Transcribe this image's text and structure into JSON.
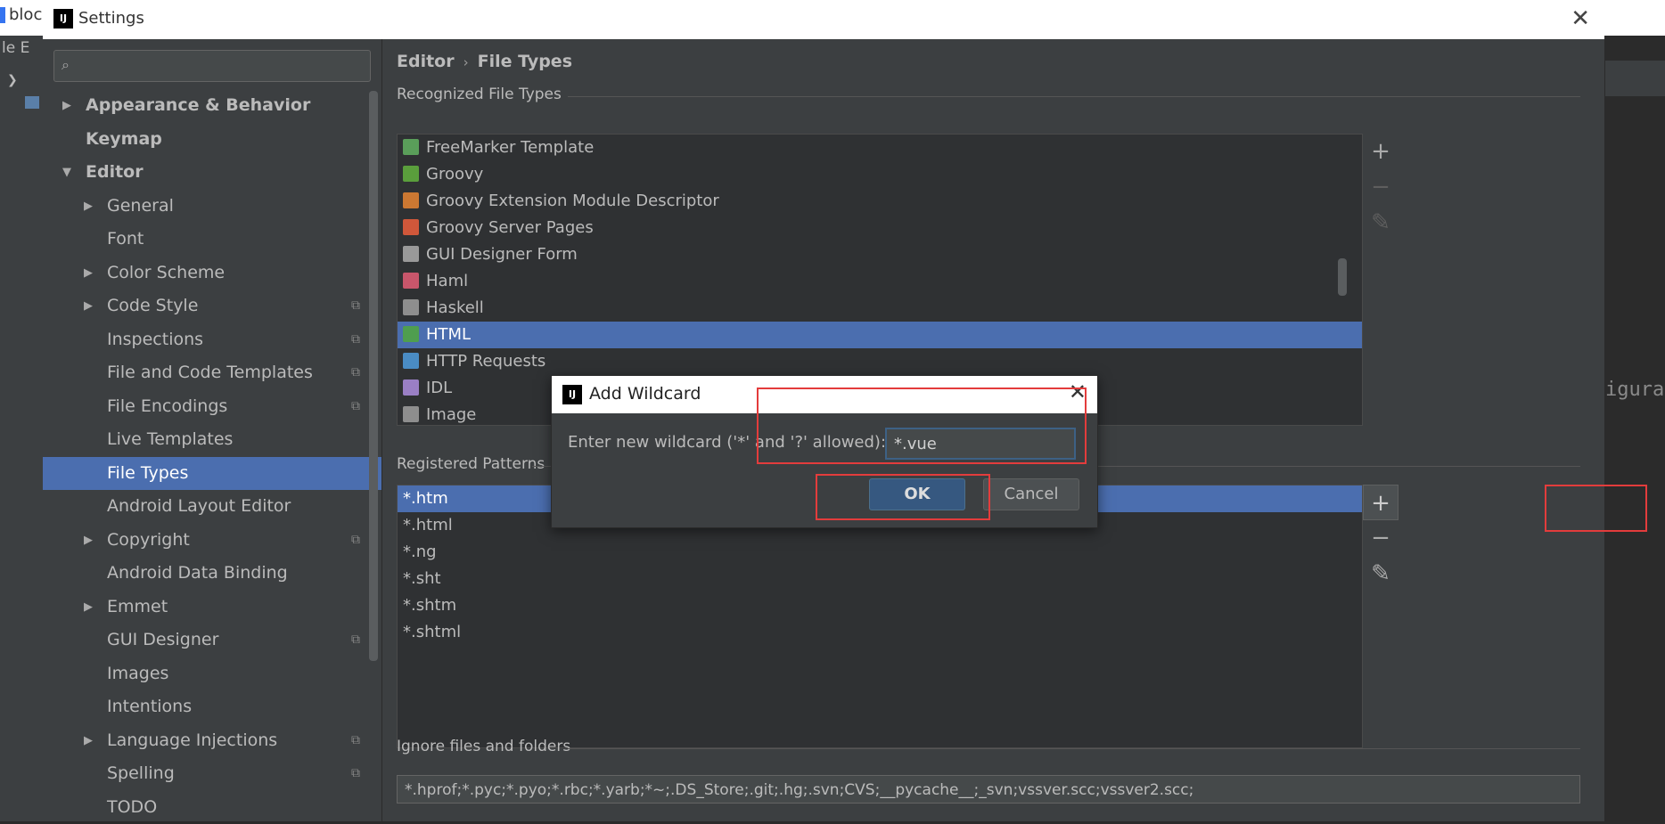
{
  "background": {
    "window_title": "block",
    "menu": "le  E",
    "right_text": "igura"
  },
  "settings": {
    "title": "Settings",
    "search": {
      "placeholder": ""
    },
    "tree": [
      {
        "label": "Appearance & Behavior",
        "bold": true,
        "arrow": "right",
        "indent": 0,
        "copy": false
      },
      {
        "label": "Keymap",
        "bold": true,
        "arrow": "",
        "indent": 0,
        "copy": false
      },
      {
        "label": "Editor",
        "bold": true,
        "arrow": "down",
        "indent": 0,
        "copy": false
      },
      {
        "label": "General",
        "arrow": "right",
        "indent": 1,
        "copy": false
      },
      {
        "label": "Font",
        "arrow": "",
        "indent": 1,
        "copy": false
      },
      {
        "label": "Color Scheme",
        "arrow": "right",
        "indent": 1,
        "copy": false
      },
      {
        "label": "Code Style",
        "arrow": "right",
        "indent": 1,
        "copy": true
      },
      {
        "label": "Inspections",
        "arrow": "",
        "indent": 1,
        "copy": true
      },
      {
        "label": "File and Code Templates",
        "arrow": "",
        "indent": 1,
        "copy": true
      },
      {
        "label": "File Encodings",
        "arrow": "",
        "indent": 1,
        "copy": true
      },
      {
        "label": "Live Templates",
        "arrow": "",
        "indent": 1,
        "copy": false
      },
      {
        "label": "File Types",
        "arrow": "",
        "indent": 1,
        "copy": false,
        "selected": true
      },
      {
        "label": "Android Layout Editor",
        "arrow": "",
        "indent": 1,
        "copy": false
      },
      {
        "label": "Copyright",
        "arrow": "right",
        "indent": 1,
        "copy": true
      },
      {
        "label": "Android Data Binding",
        "arrow": "",
        "indent": 1,
        "copy": false
      },
      {
        "label": "Emmet",
        "arrow": "right",
        "indent": 1,
        "copy": false
      },
      {
        "label": "GUI Designer",
        "arrow": "",
        "indent": 1,
        "copy": true
      },
      {
        "label": "Images",
        "arrow": "",
        "indent": 1,
        "copy": false
      },
      {
        "label": "Intentions",
        "arrow": "",
        "indent": 1,
        "copy": false
      },
      {
        "label": "Language Injections",
        "arrow": "right",
        "indent": 1,
        "copy": true
      },
      {
        "label": "Spelling",
        "arrow": "",
        "indent": 1,
        "copy": true
      },
      {
        "label": "TODO",
        "arrow": "",
        "indent": 1,
        "copy": false
      }
    ],
    "breadcrumb": [
      "Editor",
      "File Types"
    ],
    "recognized_title": "Recognized File Types",
    "file_types": [
      {
        "label": "FreeMarker Template",
        "icon": "ftl",
        "color": "#5a9e5a"
      },
      {
        "label": "Groovy",
        "icon": "G",
        "color": "#5a9e3c"
      },
      {
        "label": "Groovy Extension Module Descriptor",
        "icon": "bar",
        "color": "#cc7832"
      },
      {
        "label": "Groovy Server Pages",
        "icon": "GSP",
        "color": "#d0573a"
      },
      {
        "label": "GUI Designer Form",
        "icon": "form",
        "color": "#999999"
      },
      {
        "label": "Haml",
        "icon": "h",
        "color": "#c8566b"
      },
      {
        "label": "Haskell",
        "icon": "hs",
        "color": "#8e8e8e"
      },
      {
        "label": "HTML",
        "icon": "H",
        "color": "#4f9e4f",
        "selected": true
      },
      {
        "label": "HTTP Requests",
        "icon": "API",
        "color": "#4a8cc4"
      },
      {
        "label": "IDL",
        "icon": "IDL",
        "color": "#9a7fc4"
      },
      {
        "label": "Image",
        "icon": "img",
        "color": "#8e8e8e"
      }
    ],
    "patterns_title": "Registered Patterns",
    "patterns": [
      {
        "label": "*.htm",
        "selected": true
      },
      {
        "label": "*.html"
      },
      {
        "label": "*.ng"
      },
      {
        "label": "*.sht"
      },
      {
        "label": "*.shtm"
      },
      {
        "label": "*.shtml"
      }
    ],
    "ignore_title": "Ignore files and folders",
    "ignore_value": "*.hprof;*.pyc;*.pyo;*.rbc;*.yarb;*~;.DS_Store;.git;.hg;.svn;CVS;__pycache__;_svn;vssver.scc;vssver2.scc;",
    "toolbar": {
      "add": "+",
      "remove": "−",
      "edit": "✎"
    }
  },
  "dialog": {
    "title": "Add Wildcard",
    "label": "Enter new wildcard ('*' and '?' allowed):",
    "input_value": "*.vue",
    "ok": "OK",
    "cancel": "Cancel"
  },
  "colors": {
    "selection": "#4b6eaf",
    "panel": "#3c3f41",
    "annotation": "#e33c3c"
  }
}
